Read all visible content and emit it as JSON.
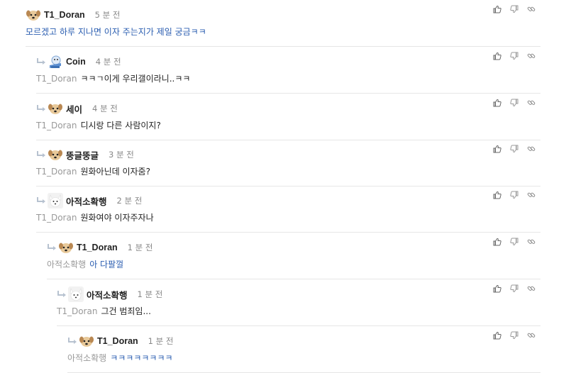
{
  "comments": [
    {
      "nick": "T1_Doran",
      "time": "5 분 전",
      "mention": "",
      "text": "모르겠고 하루 지나면 이자 주는지가 제일 궁금ㅋㅋ",
      "avatar": "dog-avatar",
      "blue": true
    },
    {
      "nick": "Coin",
      "time": "4 분 전",
      "mention": "T1_Doran",
      "text": "ㅋㅋㄱ이게 우리갤이라니..ㅋㅋ",
      "avatar": "coin-mascot-avatar",
      "blue": false
    },
    {
      "nick": "세이",
      "time": "4 분 전",
      "mention": "T1_Doran",
      "text": "디시랑 다른 사람이지?",
      "avatar": "dog-avatar",
      "blue": false
    },
    {
      "nick": "뚱글뚱글",
      "time": "3 분 전",
      "mention": "T1_Doran",
      "text": "원화아닌데 이자줌?",
      "avatar": "dog-avatar",
      "blue": false
    },
    {
      "nick": "아적소확행",
      "time": "2 분 전",
      "mention": "T1_Doran",
      "text": "원화여야 이자주자나",
      "avatar": "white-dog-avatar",
      "blue": false
    },
    {
      "nick": "T1_Doran",
      "time": "1 분 전",
      "mention": "아적소확행",
      "text": "아 다팔껄",
      "avatar": "dog-avatar",
      "blue": true
    },
    {
      "nick": "아적소확행",
      "time": "1 분 전",
      "mention": "T1_Doran",
      "text": "그건 범죄임...",
      "avatar": "white-dog-avatar",
      "blue": false
    },
    {
      "nick": "T1_Doran",
      "time": "1 분 전",
      "mention": "아적소확행",
      "text": "ㅋㅋㅋㅋㅋㅋㅋㅋ",
      "avatar": "dog-avatar",
      "blue": true
    }
  ],
  "icons": {
    "like": "thumbs-up-icon",
    "dislike": "thumbs-down-icon",
    "share": "link-icon",
    "reply": "reply-arrow-icon"
  },
  "colors": {
    "link_text": "#2a5db0",
    "mention": "#999999",
    "nick": "#222222",
    "time": "#888888",
    "divider": "#e6e6e6"
  }
}
